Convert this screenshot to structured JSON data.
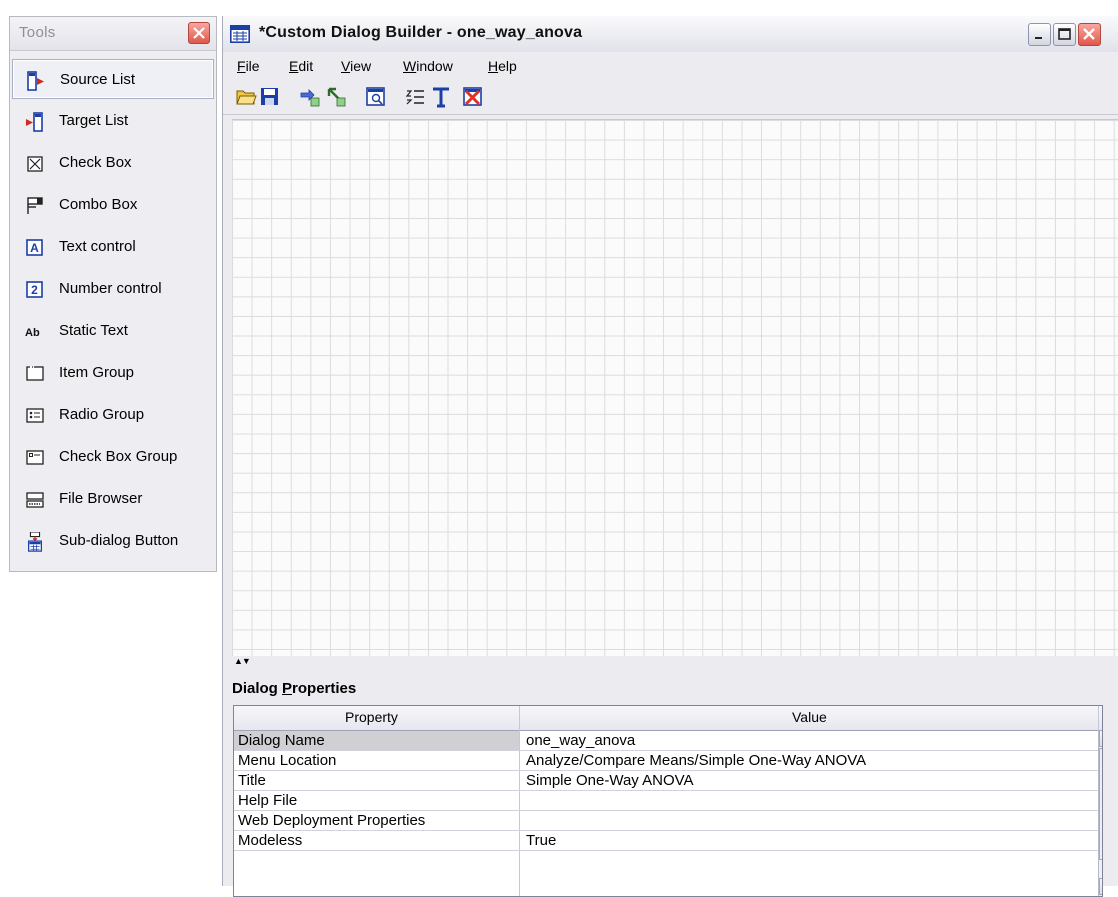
{
  "tools_palette": {
    "title": "Tools",
    "items": [
      {
        "label": "Source List",
        "icon": "source-list-icon"
      },
      {
        "label": "Target List",
        "icon": "target-list-icon"
      },
      {
        "label": "Check Box",
        "icon": "check-box-icon"
      },
      {
        "label": "Combo Box",
        "icon": "combo-box-icon"
      },
      {
        "label": "Text control",
        "icon": "text-control-icon"
      },
      {
        "label": "Number control",
        "icon": "number-control-icon"
      },
      {
        "label": "Static Text",
        "icon": "static-text-icon"
      },
      {
        "label": "Item Group",
        "icon": "item-group-icon"
      },
      {
        "label": "Radio Group",
        "icon": "radio-group-icon"
      },
      {
        "label": "Check Box Group",
        "icon": "check-box-group-icon"
      },
      {
        "label": "File Browser",
        "icon": "file-browser-icon"
      },
      {
        "label": "Sub-dialog Button",
        "icon": "sub-dialog-button-icon"
      }
    ],
    "number_icon_glyph": "2",
    "static_text_glyph": "Ab",
    "text_control_glyph": "A"
  },
  "window": {
    "title": "*Custom Dialog Builder - one_way_anova",
    "menu": [
      {
        "mnemonic": "F",
        "rest": "ile"
      },
      {
        "mnemonic": "E",
        "rest": "dit"
      },
      {
        "mnemonic": "V",
        "rest": "iew"
      },
      {
        "mnemonic": "W",
        "rest": "indow"
      },
      {
        "mnemonic": "H",
        "rest": "elp"
      }
    ],
    "toolbar_icons": [
      "open-folder-icon",
      "save-icon",
      "install-icon",
      "uninstall-icon",
      "preview-icon",
      "tab-order-icon",
      "build-icon",
      "delete-icon"
    ]
  },
  "properties": {
    "title_prefix": "Dialog ",
    "title_mnemonic": "P",
    "title_rest": "roperties",
    "col_property": "Property",
    "col_value": "Value",
    "rows": [
      {
        "name": "Dialog Name",
        "value": "one_way_anova"
      },
      {
        "name": "Menu Location",
        "value": "Analyze/Compare Means/Simple One-Way ANOVA"
      },
      {
        "name": "Title",
        "value": "Simple One-Way ANOVA"
      },
      {
        "name": "Help File",
        "value": ""
      },
      {
        "name": "Web Deployment Properties",
        "value": ""
      },
      {
        "name": "Modeless",
        "value": "True"
      }
    ]
  },
  "colors": {
    "accent_red": "#e0584b",
    "blue": "#1b3fa6"
  }
}
